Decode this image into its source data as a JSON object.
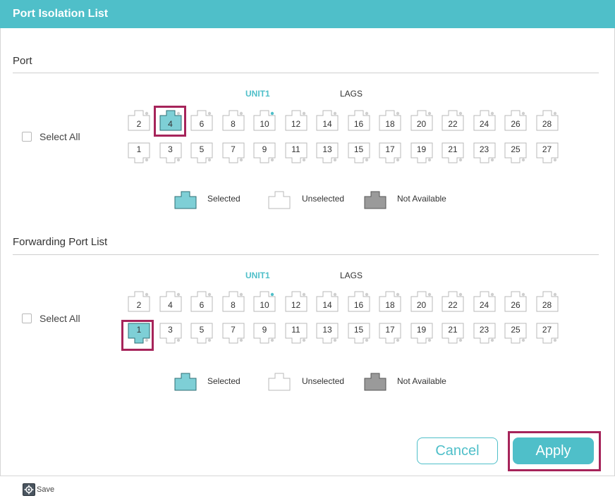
{
  "header": {
    "title": "Port Isolation List"
  },
  "port_section": {
    "title": "Port",
    "unit_tab": "UNIT1",
    "lags_tab": "LAGS",
    "select_all_label": "Select All",
    "top_row": [
      "2",
      "4",
      "6",
      "8",
      "10",
      "12",
      "14",
      "16",
      "18",
      "20",
      "22",
      "24",
      "26",
      "28"
    ],
    "bottom_row": [
      "1",
      "3",
      "5",
      "7",
      "9",
      "11",
      "13",
      "15",
      "17",
      "19",
      "21",
      "23",
      "25",
      "27"
    ],
    "selected_ports": [
      "4"
    ]
  },
  "forwarding_section": {
    "title": "Forwarding Port List",
    "unit_tab": "UNIT1",
    "lags_tab": "LAGS",
    "select_all_label": "Select All",
    "top_row": [
      "2",
      "4",
      "6",
      "8",
      "10",
      "12",
      "14",
      "16",
      "18",
      "20",
      "22",
      "24",
      "26",
      "28"
    ],
    "bottom_row": [
      "1",
      "3",
      "5",
      "7",
      "9",
      "11",
      "13",
      "15",
      "17",
      "19",
      "21",
      "23",
      "25",
      "27"
    ],
    "selected_ports": [
      "1"
    ]
  },
  "legend": {
    "selected": "Selected",
    "unselected": "Unselected",
    "not_available": "Not Available"
  },
  "buttons": {
    "cancel": "Cancel",
    "apply": "Apply"
  },
  "save": {
    "label": "Save"
  },
  "colors": {
    "accent": "#4fbfc9",
    "highlight": "#a6245a",
    "selected_fill": "#7ecfd6",
    "not_available_fill": "#9a9a9a"
  },
  "icons": {
    "port": "ethernet-port-icon",
    "save": "save-gear-icon"
  }
}
